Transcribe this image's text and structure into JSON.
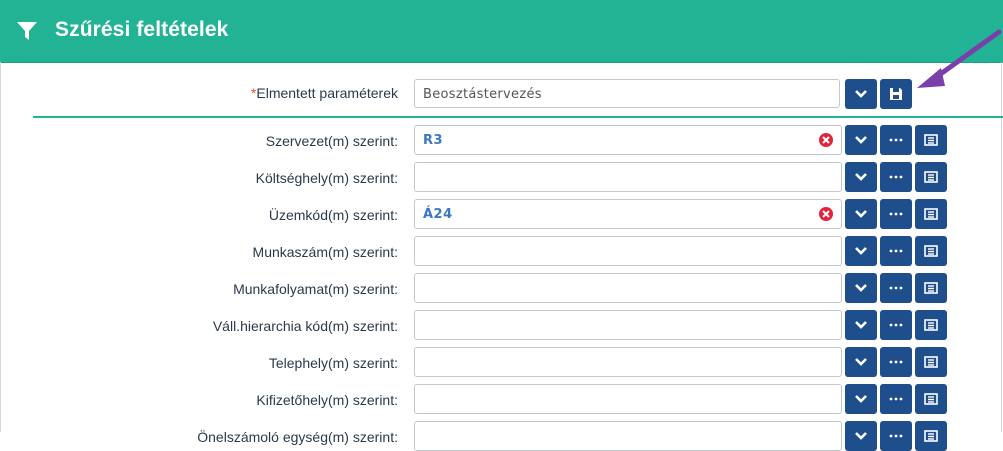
{
  "header": {
    "title": "Szűrési feltételek",
    "icon": "filter-icon"
  },
  "saved_params": {
    "required_mark": "*",
    "label": "Elmentett paraméterek",
    "value": "Beosztástervezés"
  },
  "rows": [
    {
      "label": "Szervezet(m) szerint:",
      "value": "R3"
    },
    {
      "label": "Költséghely(m) szerint:",
      "value": ""
    },
    {
      "label": "Üzemkód(m) szerint:",
      "value": "Á24"
    },
    {
      "label": "Munkaszám(m) szerint:",
      "value": ""
    },
    {
      "label": "Munkafolyamat(m) szerint:",
      "value": ""
    },
    {
      "label": "Váll.hierarchia kód(m) szerint:",
      "value": ""
    },
    {
      "label": "Telephely(m) szerint:",
      "value": ""
    },
    {
      "label": "Kifizetőhely(m) szerint:",
      "value": ""
    },
    {
      "label": "Önelszámoló egység(m) szerint:",
      "value": ""
    }
  ],
  "colors": {
    "header": "#22b394",
    "button": "#1f4e8c",
    "clear": "#e0243a",
    "arrow": "#7a3fa8"
  }
}
